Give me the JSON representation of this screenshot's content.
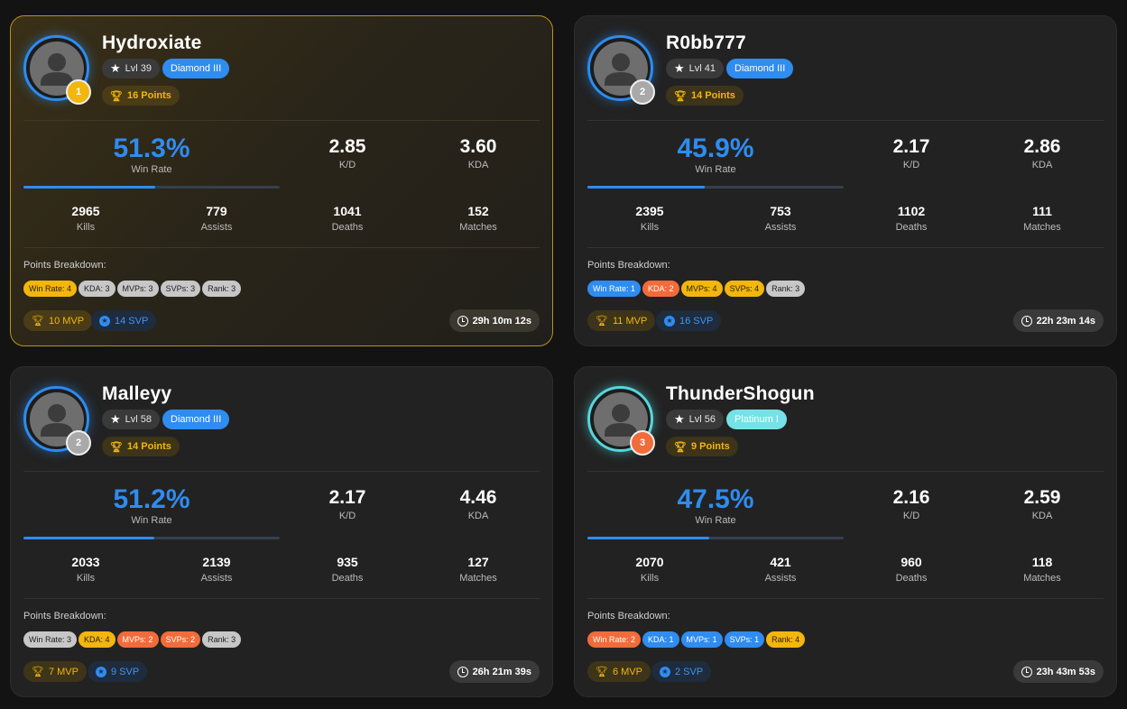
{
  "labels": {
    "win_rate": "Win Rate",
    "kd": "K/D",
    "kda": "KDA",
    "kills": "Kills",
    "assists": "Assists",
    "deaths": "Deaths",
    "matches": "Matches",
    "points_breakdown": "Points Breakdown:"
  },
  "colors": {
    "accent_blue": "#2f8cf0",
    "gold": "#f3b60f",
    "silver": "#a9a9a9",
    "bronze": "#f26b3a",
    "platinum": "#74e2e6"
  },
  "players": [
    {
      "name": "Hydroxiate",
      "rank": "1",
      "level": "Lvl 39",
      "tier": "Diamond III",
      "points": "16 Points",
      "win_rate": "51.3%",
      "win_rate_fraction": 0.513,
      "kd": "2.85",
      "kda": "3.60",
      "kills": "2965",
      "assists": "779",
      "deaths": "1041",
      "matches": "152",
      "breakdown": [
        "Win Rate: 4",
        "KDA: 3",
        "MVPs: 3",
        "SVPs: 3",
        "Rank: 3"
      ],
      "mvp": "10 MVP",
      "svp": "14 SVP",
      "playtime": "29h 10m 12s"
    },
    {
      "name": "R0bb777",
      "rank": "2",
      "level": "Lvl 41",
      "tier": "Diamond III",
      "points": "14 Points",
      "win_rate": "45.9%",
      "win_rate_fraction": 0.459,
      "kd": "2.17",
      "kda": "2.86",
      "kills": "2395",
      "assists": "753",
      "deaths": "1102",
      "matches": "111",
      "breakdown": [
        "Win Rate: 1",
        "KDA: 2",
        "MVPs: 4",
        "SVPs: 4",
        "Rank: 3"
      ],
      "mvp": "11 MVP",
      "svp": "16 SVP",
      "playtime": "22h 23m 14s"
    },
    {
      "name": "Malleyy",
      "rank": "2",
      "level": "Lvl 58",
      "tier": "Diamond III",
      "points": "14 Points",
      "win_rate": "51.2%",
      "win_rate_fraction": 0.512,
      "kd": "2.17",
      "kda": "4.46",
      "kills": "2033",
      "assists": "2139",
      "deaths": "935",
      "matches": "127",
      "breakdown": [
        "Win Rate: 3",
        "KDA: 4",
        "MVPs: 2",
        "SVPs: 2",
        "Rank: 3"
      ],
      "mvp": "7 MVP",
      "svp": "9 SVP",
      "playtime": "26h 21m 39s"
    },
    {
      "name": "ThunderShogun",
      "rank": "3",
      "level": "Lvl 56",
      "tier": "Platinum I",
      "points": "9 Points",
      "win_rate": "47.5%",
      "win_rate_fraction": 0.475,
      "kd": "2.16",
      "kda": "2.59",
      "kills": "2070",
      "assists": "421",
      "deaths": "960",
      "matches": "118",
      "breakdown": [
        "Win Rate: 2",
        "KDA: 1",
        "MVPs: 1",
        "SVPs: 1",
        "Rank: 4"
      ],
      "mvp": "6 MVP",
      "svp": "2 SVP",
      "playtime": "23h 43m 53s"
    }
  ]
}
